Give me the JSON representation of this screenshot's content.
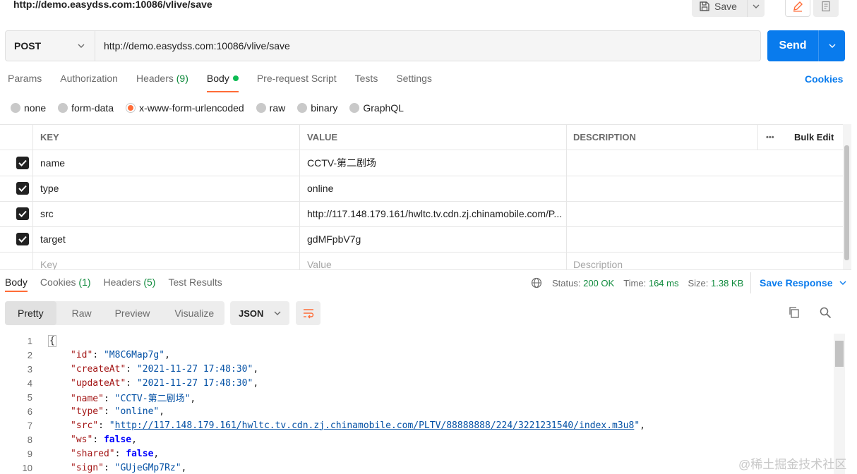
{
  "request": {
    "title": "http://demo.easydss.com:10086/vlive/save",
    "save_label": "Save",
    "method": "POST",
    "url": "http://demo.easydss.com:10086/vlive/save",
    "send_label": "Send"
  },
  "request_tabs": {
    "params": "Params",
    "authorization": "Authorization",
    "headers_label": "Headers",
    "headers_count": "(9)",
    "body": "Body",
    "prerequest": "Pre-request Script",
    "tests": "Tests",
    "settings": "Settings",
    "cookies": "Cookies"
  },
  "body_types": [
    "none",
    "form-data",
    "x-www-form-urlencoded",
    "raw",
    "binary",
    "GraphQL"
  ],
  "body_type_selected": "x-www-form-urlencoded",
  "params_table": {
    "headers": {
      "key": "KEY",
      "value": "VALUE",
      "description": "DESCRIPTION",
      "more": "•••",
      "bulk_edit": "Bulk Edit"
    },
    "rows": [
      {
        "checked": true,
        "key": "name",
        "value": "CCTV-第二剧场"
      },
      {
        "checked": true,
        "key": "type",
        "value": "online"
      },
      {
        "checked": true,
        "key": "src",
        "value": "http://117.148.179.161/hwltc.tv.cdn.zj.chinamobile.com/P..."
      },
      {
        "checked": true,
        "key": "target",
        "value": "gdMFpbV7g"
      }
    ],
    "placeholders": {
      "key": "Key",
      "value": "Value",
      "description": "Description"
    }
  },
  "response_tabs": {
    "body": "Body",
    "cookies_label": "Cookies",
    "cookies_count": "(1)",
    "headers_label": "Headers",
    "headers_count": "(5)",
    "test_results": "Test Results"
  },
  "response_status": {
    "status_label": "Status:",
    "status_value": "200 OK",
    "time_label": "Time:",
    "time_value": "164 ms",
    "size_label": "Size:",
    "size_value": "1.38 KB",
    "save_response": "Save Response"
  },
  "view_options": {
    "pretty": "Pretty",
    "raw": "Raw",
    "preview": "Preview",
    "visualize": "Visualize",
    "format": "JSON"
  },
  "code_lines": [
    {
      "n": "1",
      "brace": "{"
    },
    {
      "n": "2",
      "key": "\"id\"",
      "str": "\"M8C6Map7g\"",
      "tail": ","
    },
    {
      "n": "3",
      "key": "\"createAt\"",
      "str": "\"2021-11-27 17:48:30\"",
      "tail": ","
    },
    {
      "n": "4",
      "key": "\"updateAt\"",
      "str": "\"2021-11-27 17:48:30\"",
      "tail": ","
    },
    {
      "n": "5",
      "key": "\"name\"",
      "str": "\"CCTV-第二剧场\"",
      "tail": ","
    },
    {
      "n": "6",
      "key": "\"type\"",
      "str": "\"online\"",
      "tail": ","
    },
    {
      "n": "7",
      "key": "\"src\"",
      "link": "http://117.148.179.161/hwltc.tv.cdn.zj.chinamobile.com/PLTV/88888888/224/3221231540/index.m3u8",
      "tail": ","
    },
    {
      "n": "8",
      "key": "\"ws\"",
      "kw": "false",
      "tail": ","
    },
    {
      "n": "9",
      "key": "\"shared\"",
      "kw": "false",
      "tail": ","
    },
    {
      "n": "10",
      "key": "\"sign\"",
      "str": "\"GUjeGMp7Rz\"",
      "tail": ","
    }
  ],
  "watermark": "@稀土掘金技术社区",
  "colors": {
    "accent": "#ff6c37",
    "primary": "#097bed",
    "success": "#0f8a3c"
  }
}
